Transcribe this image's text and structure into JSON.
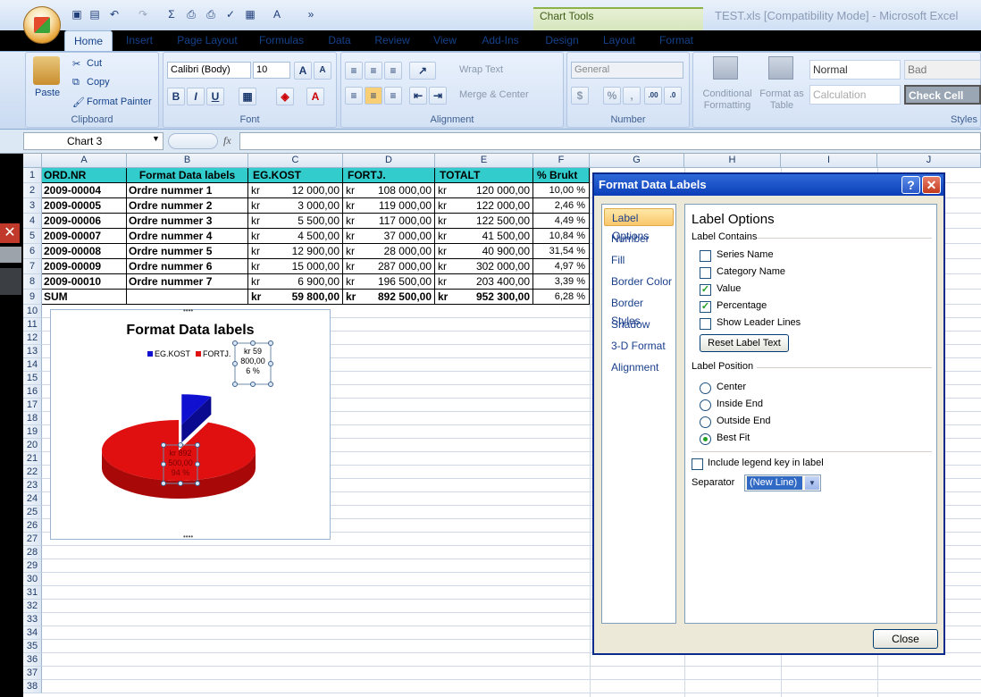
{
  "window": {
    "title": "TEST.xls  [Compatibility Mode] - Microsoft Excel",
    "context_tools": "Chart Tools"
  },
  "tabs": [
    "Home",
    "Insert",
    "Page Layout",
    "Formulas",
    "Data",
    "Review",
    "View",
    "Add-Ins",
    "Design",
    "Layout",
    "Format"
  ],
  "ribbon": {
    "clipboard": {
      "paste": "Paste",
      "cut": "Cut",
      "copy": "Copy",
      "format_painter": "Format Painter",
      "label": "Clipboard"
    },
    "font": {
      "name": "Calibri (Body)",
      "size": "10",
      "bold": "B",
      "italic": "I",
      "underline": "U",
      "label": "Font"
    },
    "alignment": {
      "wrap": "Wrap Text",
      "merge": "Merge & Center",
      "label": "Alignment"
    },
    "number": {
      "format": "General",
      "percent": "%",
      "comma": ",",
      "label": "Number"
    },
    "styles": {
      "conditional": "Conditional Formatting",
      "format_table": "Format as Table",
      "normal": "Normal",
      "bad": "Bad",
      "calculation": "Calculation",
      "check_cell": "Check Cell",
      "label": "Styles"
    }
  },
  "formula_bar": {
    "name_box": "Chart 3",
    "fx": "fx"
  },
  "columns": [
    "A",
    "B",
    "C",
    "D",
    "E",
    "F",
    "G",
    "H",
    "I",
    "J"
  ],
  "rows": [
    "1",
    "2",
    "3",
    "4",
    "5",
    "6",
    "7",
    "8",
    "9",
    "10",
    "11",
    "12",
    "13",
    "14",
    "15",
    "16",
    "17",
    "18",
    "19",
    "20",
    "21",
    "22",
    "23",
    "24",
    "25",
    "26",
    "27",
    "28",
    "29",
    "30",
    "31",
    "32",
    "33",
    "34",
    "35",
    "36",
    "37",
    "38"
  ],
  "table": {
    "headers": [
      "ORD.NR",
      "Format Data labels",
      "EG.KOST",
      "FORTJ.",
      "TOTALT",
      "% Brukt"
    ],
    "rows": [
      {
        "ord": "2009-00004",
        "name": "Ordre nummer 1",
        "cur": "kr",
        "eg": "12 000,00",
        "fort": "108 000,00",
        "tot": "120 000,00",
        "pct": "10,00 %"
      },
      {
        "ord": "2009-00005",
        "name": "Ordre nummer 2",
        "cur": "kr",
        "eg": "3 000,00",
        "fort": "119 000,00",
        "tot": "122 000,00",
        "pct": "2,46 %"
      },
      {
        "ord": "2009-00006",
        "name": "Ordre nummer 3",
        "cur": "kr",
        "eg": "5 500,00",
        "fort": "117 000,00",
        "tot": "122 500,00",
        "pct": "4,49 %"
      },
      {
        "ord": "2009-00007",
        "name": "Ordre nummer 4",
        "cur": "kr",
        "eg": "4 500,00",
        "fort": "37 000,00",
        "tot": "41 500,00",
        "pct": "10,84 %"
      },
      {
        "ord": "2009-00008",
        "name": "Ordre nummer 5",
        "cur": "kr",
        "eg": "12 900,00",
        "fort": "28 000,00",
        "tot": "40 900,00",
        "pct": "31,54 %"
      },
      {
        "ord": "2009-00009",
        "name": "Ordre nummer 6",
        "cur": "kr",
        "eg": "15 000,00",
        "fort": "287 000,00",
        "tot": "302 000,00",
        "pct": "4,97 %"
      },
      {
        "ord": "2009-00010",
        "name": "Ordre nummer 7",
        "cur": "kr",
        "eg": "6 900,00",
        "fort": "196 500,00",
        "tot": "203 400,00",
        "pct": "3,39 %"
      }
    ],
    "sum": {
      "ord": "SUM",
      "cur": "kr",
      "eg": "59 800,00",
      "fort": "892 500,00",
      "tot": "952 300,00",
      "pct": "6,28 %"
    }
  },
  "chart_data": {
    "type": "pie",
    "title": "Format Data labels",
    "categories": [
      "EG.KOST",
      "FORTJ."
    ],
    "values": [
      59800,
      892500
    ],
    "labels": [
      [
        "kr 59",
        "800,00",
        "6 %"
      ],
      [
        "kr 892",
        "500,00",
        "94 %"
      ]
    ],
    "colors": [
      "#1010d0",
      "#e01010"
    ],
    "legend": "top"
  },
  "dialog": {
    "title": "Format Data Labels",
    "help": "?",
    "close_x": "✕",
    "nav": [
      "Label Options",
      "Number",
      "Fill",
      "Border Color",
      "Border Styles",
      "Shadow",
      "3-D Format",
      "Alignment"
    ],
    "heading": "Label Options",
    "contains_label": "Label Contains",
    "checks": [
      {
        "label": "Series Name",
        "checked": false
      },
      {
        "label": "Category Name",
        "checked": false
      },
      {
        "label": "Value",
        "checked": true
      },
      {
        "label": "Percentage",
        "checked": true
      },
      {
        "label": "Show Leader Lines",
        "checked": false
      }
    ],
    "reset": "Reset Label Text",
    "position_label": "Label Position",
    "positions": [
      {
        "label": "Center",
        "on": false
      },
      {
        "label": "Inside End",
        "on": false
      },
      {
        "label": "Outside End",
        "on": false
      },
      {
        "label": "Best Fit",
        "on": true
      }
    ],
    "legend_key": "Include legend key in label",
    "separator_label": "Separator",
    "separator_value": "(New Line)",
    "close": "Close"
  }
}
